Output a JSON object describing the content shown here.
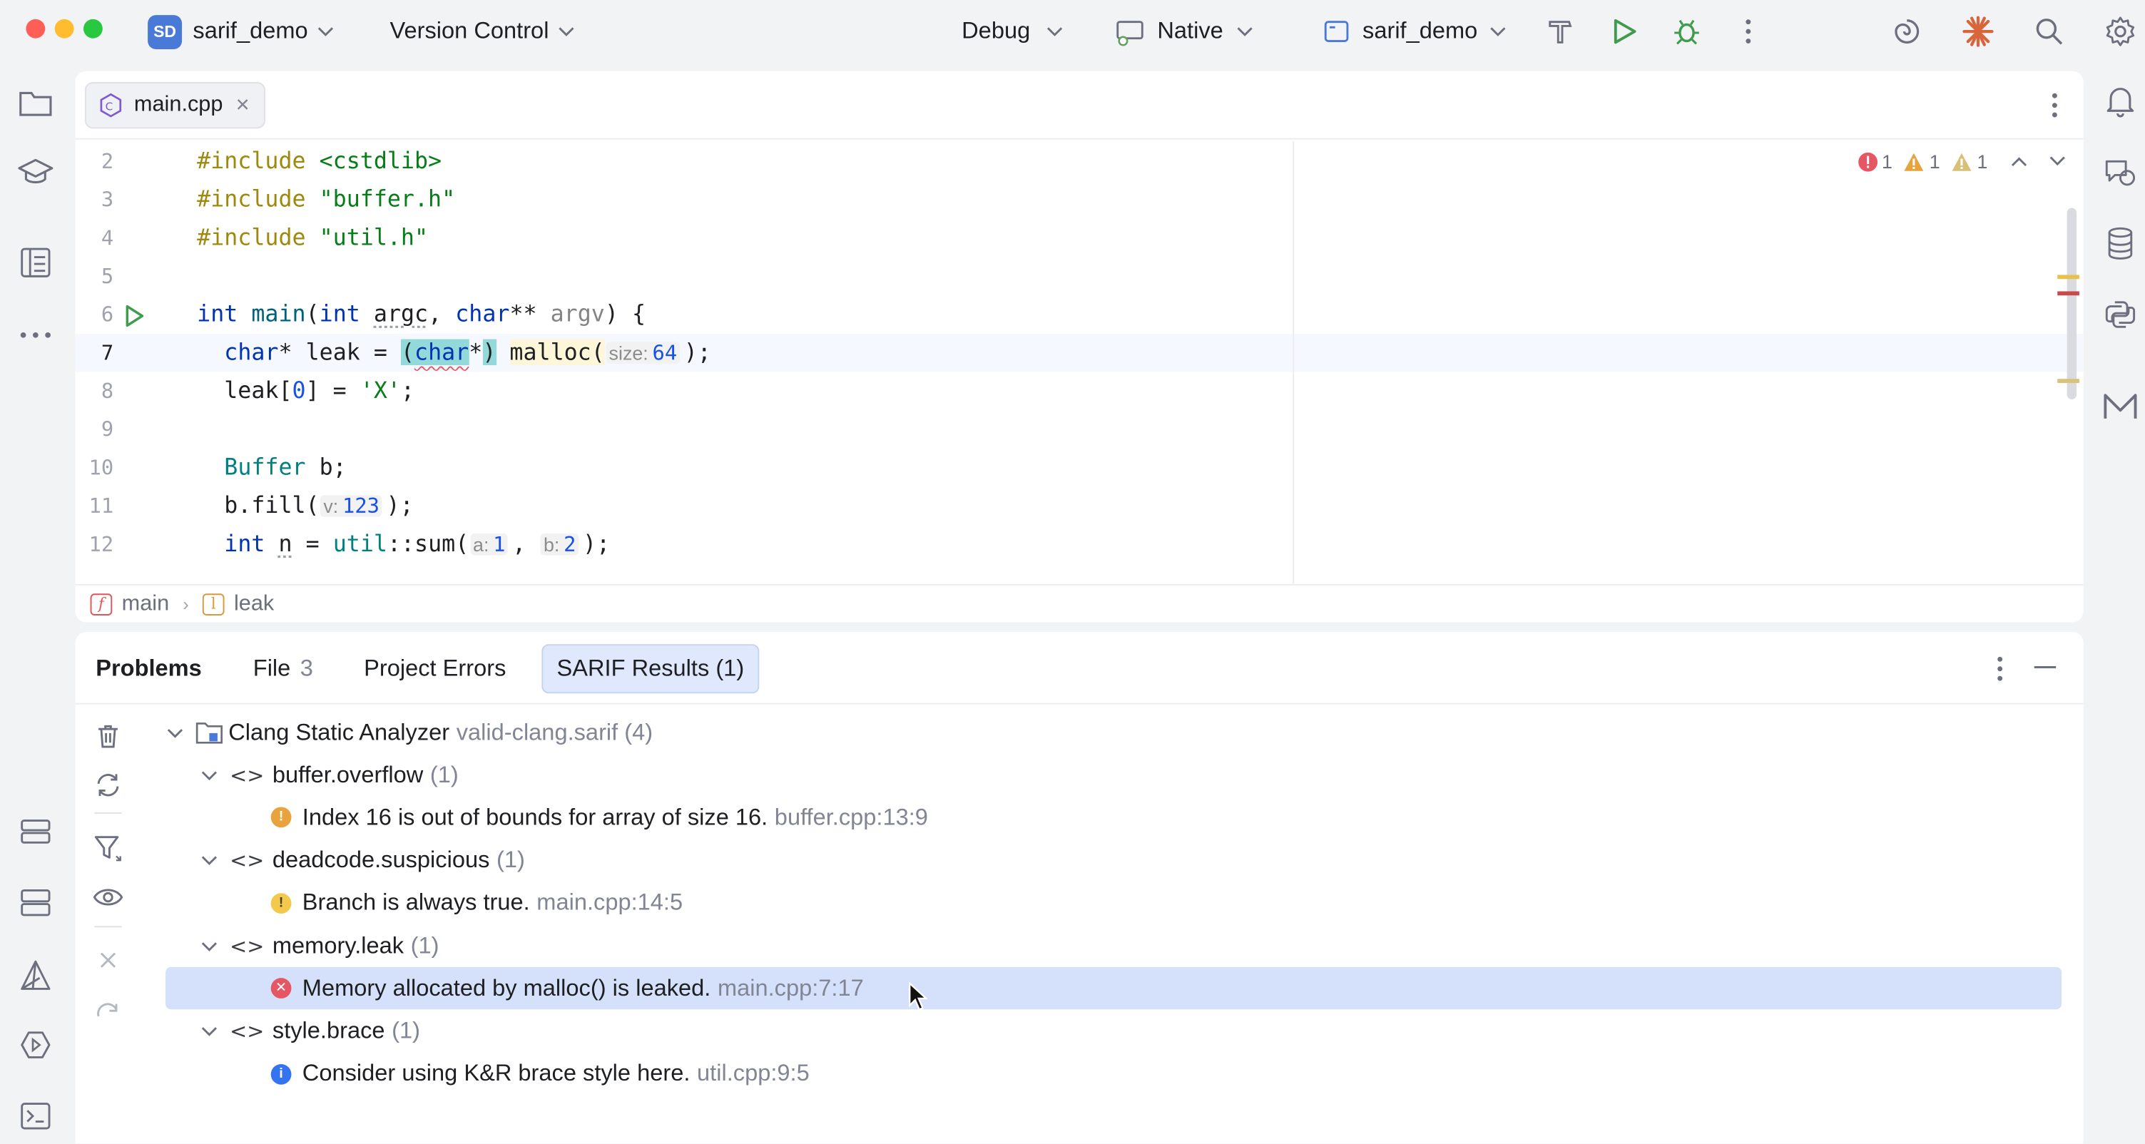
{
  "title_bar": {
    "project_badge": "SD",
    "project_name": "sarif_demo",
    "vcs_label": "Version Control",
    "build_config": "Debug",
    "toolchain": "Native",
    "run_target": "sarif_demo"
  },
  "editor": {
    "tab_label": "main.cpp",
    "inspections": {
      "errors": "1",
      "warnings": "1",
      "weak_warnings": "1"
    },
    "breadcrumb": {
      "function": "main",
      "variable": "leak",
      "function_icon": "f",
      "variable_icon": "l"
    }
  },
  "code_lines": [
    {
      "num": "2",
      "parts": [
        [
          "pp",
          "#include"
        ],
        [
          "",
          ""
        ],
        [
          "str",
          " <cstdlib>"
        ]
      ]
    },
    {
      "num": "3",
      "parts": [
        [
          "pp",
          "#include"
        ],
        [
          "str",
          " \"buffer.h\""
        ]
      ]
    },
    {
      "num": "4",
      "parts": [
        [
          "pp",
          "#include"
        ],
        [
          "str",
          " \"util.h\""
        ]
      ]
    },
    {
      "num": "5",
      "parts": []
    },
    {
      "num": "6",
      "parts": [
        [
          "kw",
          "int"
        ],
        [
          "",
          " "
        ],
        [
          "fn",
          "main"
        ],
        [
          "",
          "("
        ],
        [
          "kw",
          "int"
        ],
        [
          "",
          " "
        ],
        [
          "dotted",
          "argc"
        ],
        [
          "",
          ", "
        ],
        [
          "kw",
          "char"
        ],
        [
          "",
          "** "
        ],
        [
          "param",
          "argv"
        ],
        [
          "",
          ") {"
        ]
      ]
    },
    {
      "num": "7",
      "parts": [
        [
          "",
          "  "
        ],
        [
          "kw",
          "char"
        ],
        [
          "",
          "* "
        ],
        [
          "",
          "leak = "
        ],
        [
          "bracehl",
          "("
        ],
        [
          "kwsquig",
          "char"
        ],
        [
          "",
          "*"
        ],
        [
          "bracehl",
          ")"
        ],
        [
          "",
          " "
        ],
        [
          "mallochl",
          "malloc("
        ],
        [
          "hint",
          "size:",
          "64"
        ],
        [
          "",
          ");"
        ]
      ]
    },
    {
      "num": "8",
      "parts": [
        [
          "",
          "  leak["
        ],
        [
          "num",
          "0"
        ],
        [
          "",
          "] = "
        ],
        [
          "str",
          "'X'"
        ],
        [
          "",
          ";"
        ]
      ]
    },
    {
      "num": "9",
      "parts": []
    },
    {
      "num": "10",
      "parts": [
        [
          "",
          "  "
        ],
        [
          "type",
          "Buffer"
        ],
        [
          "",
          " b;"
        ]
      ]
    },
    {
      "num": "11",
      "parts": [
        [
          "",
          "  b.fill("
        ],
        [
          "hint",
          "v:",
          "123"
        ],
        [
          "",
          ");"
        ]
      ]
    },
    {
      "num": "12",
      "parts": [
        [
          "",
          "  "
        ],
        [
          "kw",
          "int"
        ],
        [
          "",
          " "
        ],
        [
          "dotted",
          "n"
        ],
        [
          "",
          " = "
        ],
        [
          "type",
          "util"
        ],
        [
          "",
          "::sum("
        ],
        [
          "hint",
          "a:",
          "1"
        ],
        [
          "",
          ", "
        ],
        [
          "hint",
          "b:",
          "2"
        ],
        [
          "",
          ");"
        ]
      ]
    }
  ],
  "problems": {
    "tabs": [
      {
        "label": "Problems",
        "count": ""
      },
      {
        "label": "File",
        "count": "3"
      },
      {
        "label": "Project Errors",
        "count": ""
      },
      {
        "label": "SARIF Results (1)",
        "count": ""
      }
    ],
    "tree": [
      {
        "level": 0,
        "kind": "root",
        "label": "Clang Static Analyzer",
        "detail": "valid-clang.sarif (4)"
      },
      {
        "level": 1,
        "kind": "rule",
        "label": "buffer.overflow",
        "detail": "(1)"
      },
      {
        "level": 2,
        "kind": "warning",
        "label": "Index 16 is out of bounds for array of size 16.",
        "detail": "buffer.cpp:13:9"
      },
      {
        "level": 1,
        "kind": "rule",
        "label": "deadcode.suspicious",
        "detail": "(1)"
      },
      {
        "level": 2,
        "kind": "weak",
        "label": "Branch is always true.",
        "detail": "main.cpp:14:5"
      },
      {
        "level": 1,
        "kind": "rule",
        "label": "memory.leak",
        "detail": "(1)"
      },
      {
        "level": 2,
        "kind": "error",
        "label": "Memory allocated by malloc() is leaked.",
        "detail": "main.cpp:7:17",
        "selected": true
      },
      {
        "level": 1,
        "kind": "rule",
        "label": "style.brace",
        "detail": "(1)"
      },
      {
        "level": 2,
        "kind": "info",
        "label": "Consider using K&R brace style here.",
        "detail": "util.cpp:9:5"
      }
    ]
  },
  "colors": {
    "error": "#e55765",
    "warning": "#e8a33d",
    "weak_warning": "#f2c94c",
    "info": "#3574f0",
    "selection": "#d5e1fa"
  }
}
